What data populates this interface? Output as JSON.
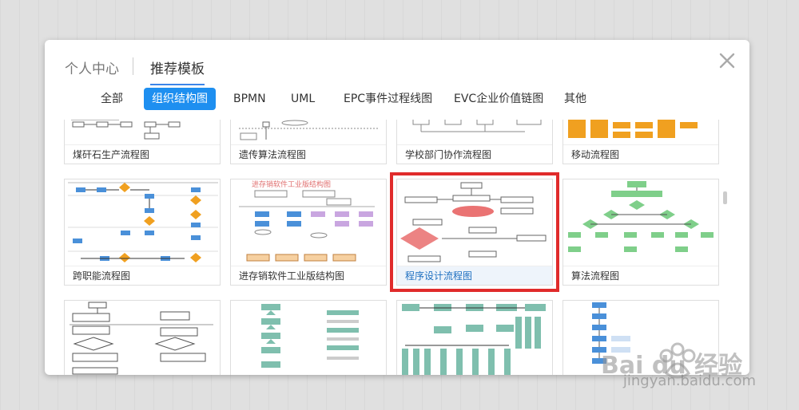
{
  "header": {
    "tabs": [
      {
        "label": "个人中心",
        "active": false
      },
      {
        "label": "推荐模板",
        "active": true
      }
    ],
    "close_icon": "close-icon"
  },
  "filters": [
    {
      "label": "全部",
      "active": false
    },
    {
      "label": "组织结构图",
      "active": true
    },
    {
      "label": "BPMN",
      "active": false
    },
    {
      "label": "UML",
      "active": false
    },
    {
      "label": "EPC事件过程线图",
      "active": false
    },
    {
      "label": "EVC企业价值链图",
      "active": false
    },
    {
      "label": "其他",
      "active": false
    }
  ],
  "cards": [
    {
      "title": "煤矸石生产流程图"
    },
    {
      "title": "遗传算法流程图"
    },
    {
      "title": "学校部门协作流程图"
    },
    {
      "title": "移动流程图"
    },
    {
      "title": "跨职能流程图"
    },
    {
      "title": "进存销软件工业版结构图"
    },
    {
      "title": "程序设计流程图",
      "selected": true
    },
    {
      "title": "算法流程图"
    },
    {
      "title": ""
    },
    {
      "title": ""
    },
    {
      "title": ""
    },
    {
      "title": ""
    }
  ],
  "thumb_text": {
    "jxc_title": "进存销软件工业版结构图"
  },
  "watermark": {
    "logo_text": "Bai du 经验",
    "url": "jingyan.baidu.com"
  },
  "colors": {
    "accent": "#1e8ff0",
    "highlight": "#e02b2b",
    "green": "#7fcf8a",
    "teal": "#7fbfae",
    "orange": "#f0a020",
    "blue_box": "#4a90d9"
  }
}
